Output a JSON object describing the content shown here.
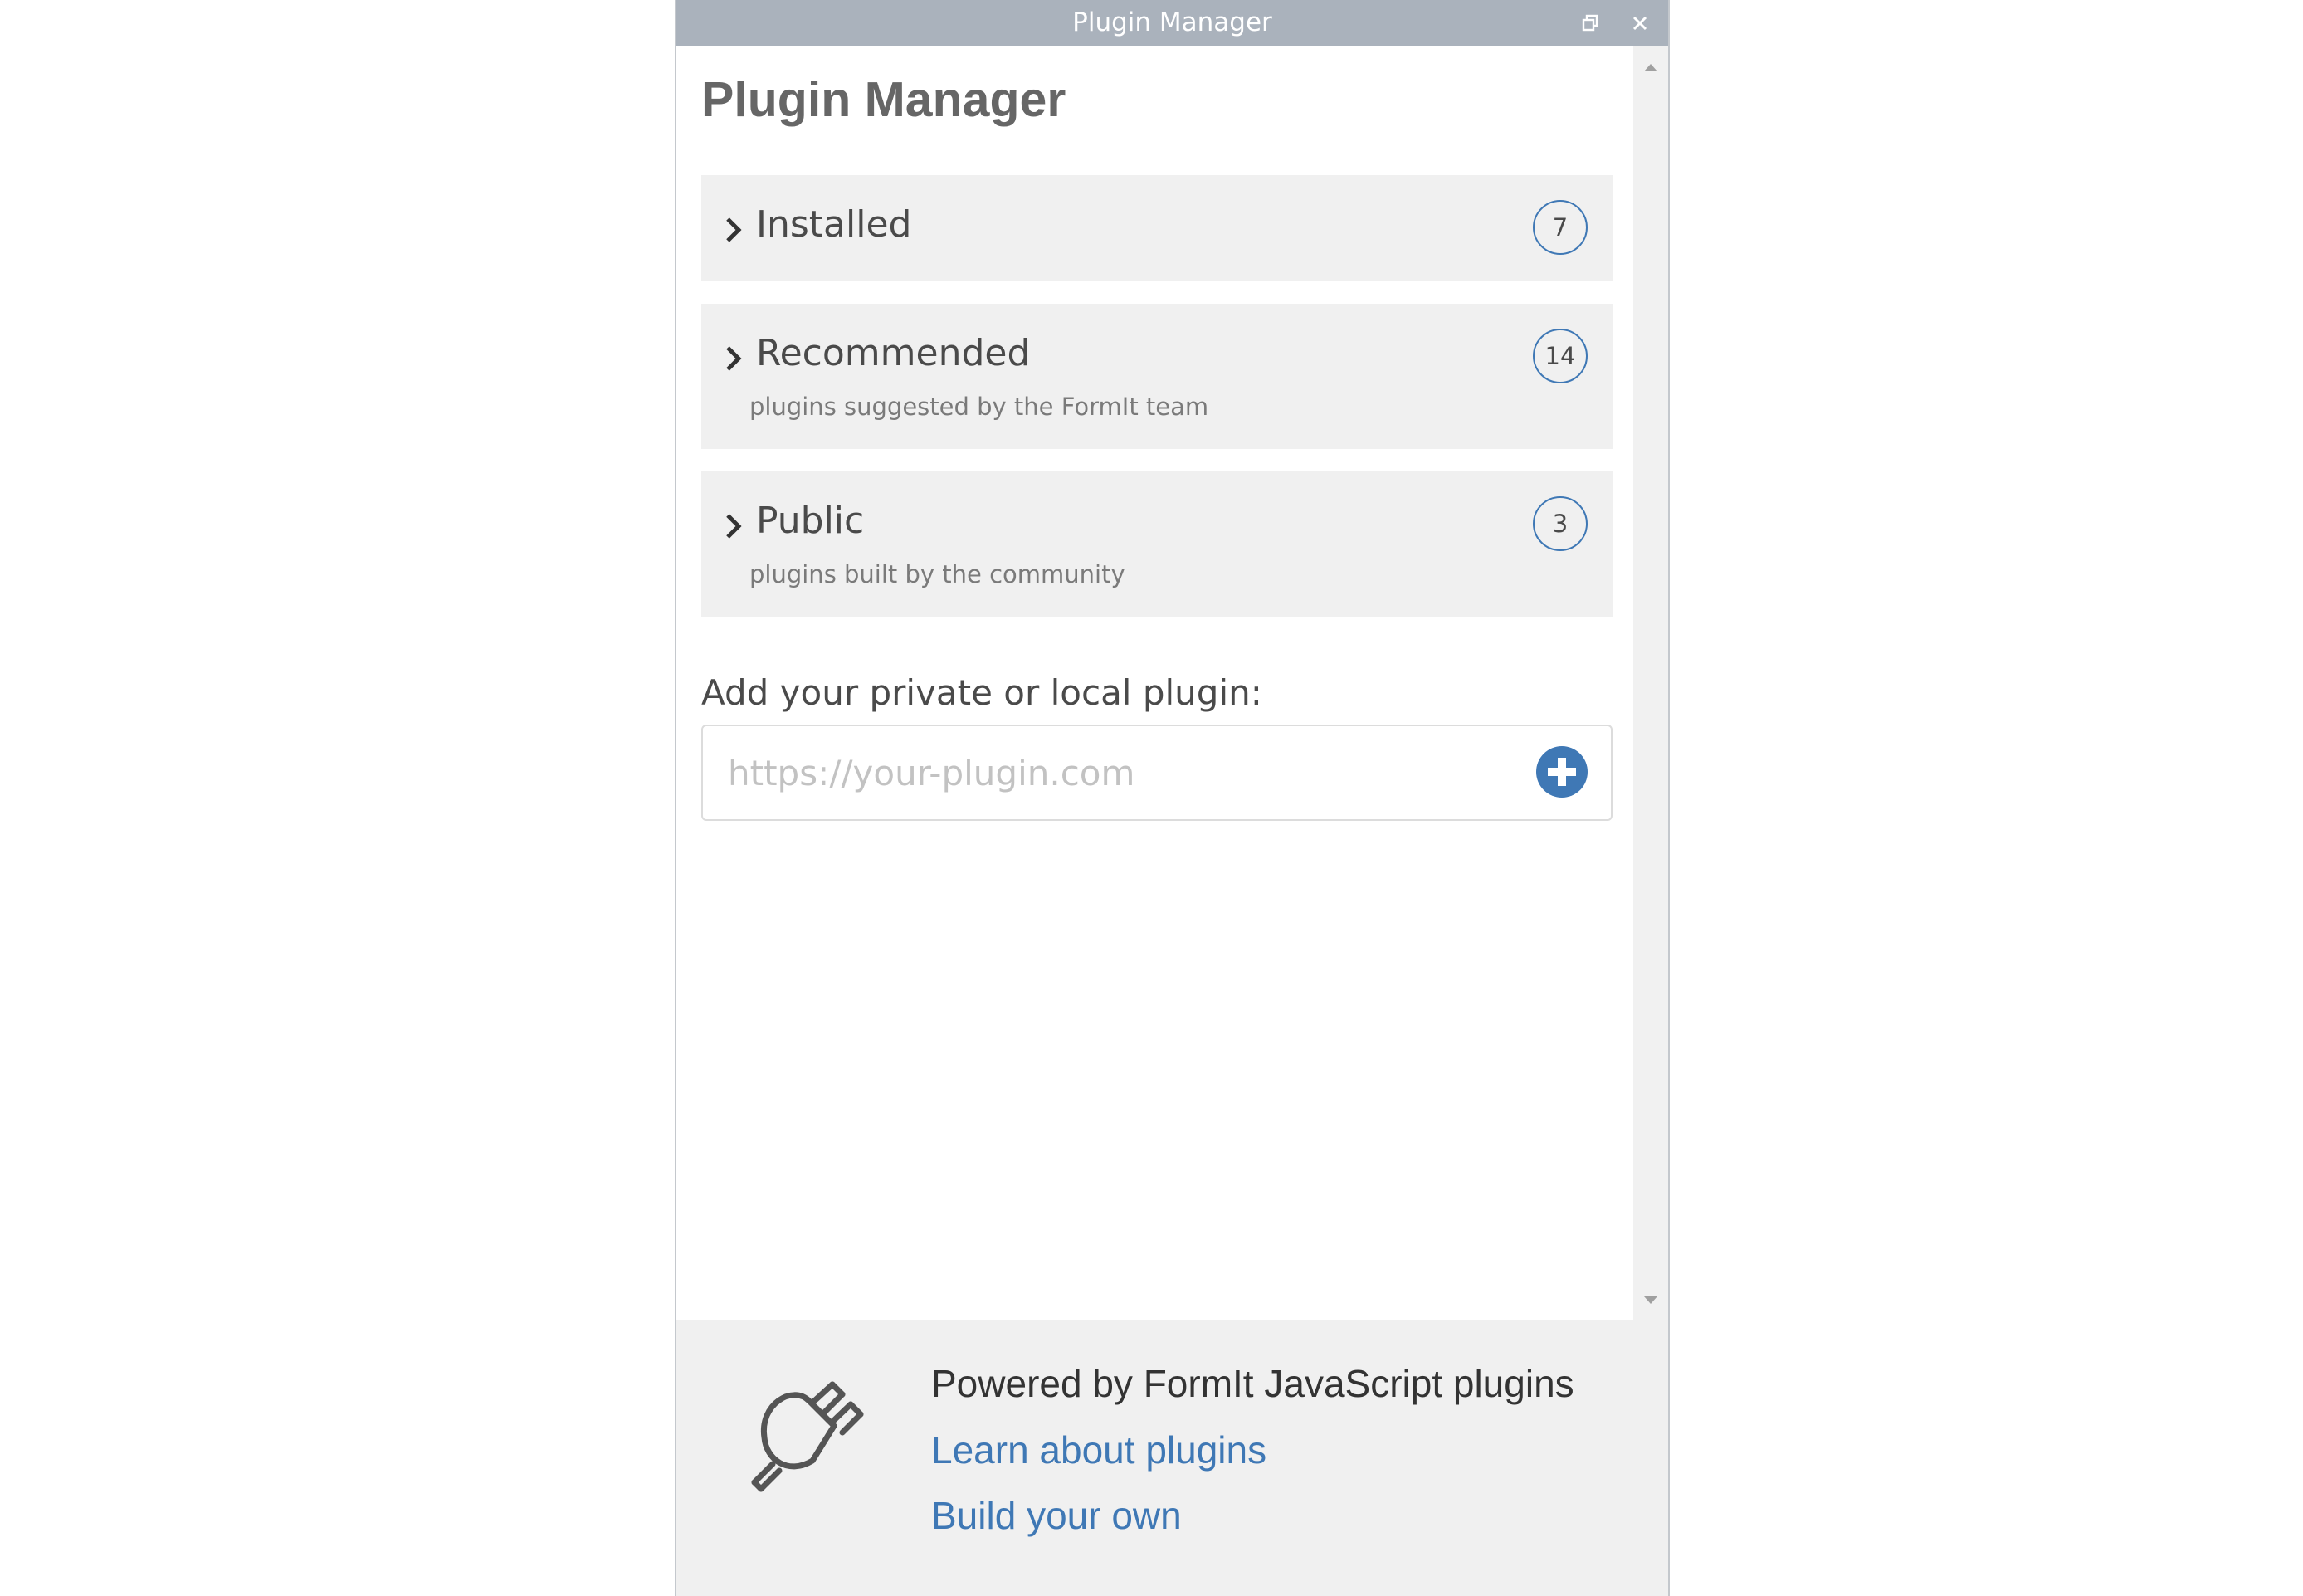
{
  "window": {
    "title": "Plugin Manager"
  },
  "page": {
    "heading": "Plugin Manager"
  },
  "sections": [
    {
      "label": "Installed",
      "subtitle": "",
      "count": "7"
    },
    {
      "label": "Recommended",
      "subtitle": "plugins suggested by the FormIt team",
      "count": "14"
    },
    {
      "label": "Public",
      "subtitle": "plugins built by the community",
      "count": "3"
    }
  ],
  "add_plugin": {
    "label": "Add your private or local plugin:",
    "placeholder": "https://your-plugin.com",
    "value": ""
  },
  "footer": {
    "powered_text": "Powered by FormIt JavaScript plugins",
    "learn_link": "Learn about plugins",
    "build_link": "Build your own"
  },
  "icons": {
    "restore": "restore-icon",
    "close": "close-icon",
    "chevron": "chevron-right-icon",
    "add": "plus-circle-icon",
    "footer": "plug-icon"
  },
  "colors": {
    "titlebar": "#aab2bc",
    "accent": "#3f78b5",
    "section_bg": "#f0f0f0",
    "heading": "#666666"
  }
}
